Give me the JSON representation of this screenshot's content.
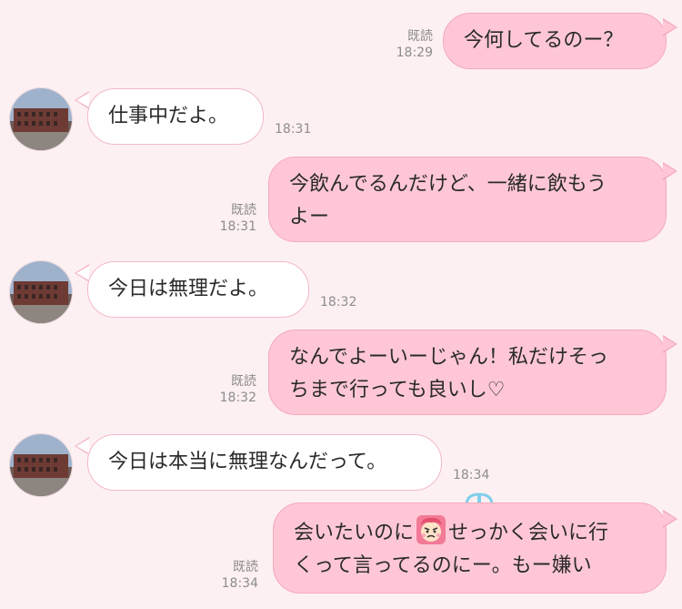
{
  "messages": [
    {
      "side": "out",
      "text": "今何してるのー？",
      "read": "既読",
      "time": "18:29"
    },
    {
      "side": "in",
      "text": "仕事中だよ。",
      "time": "18:31"
    },
    {
      "side": "out",
      "line1": "今飲んでるんだけど、一緒に飲もう",
      "line2": "よー",
      "read": "既読",
      "time": "18:31"
    },
    {
      "side": "in",
      "text": "今日は無理だよ。",
      "time": "18:32"
    },
    {
      "side": "out",
      "line1": "なんでよーいーじゃん！私だけそっ",
      "line2": "ちまで行っても良いし♡",
      "read": "既読",
      "time": "18:32"
    },
    {
      "side": "in",
      "text": "今日は本当に無理なんだって。",
      "time": "18:34"
    },
    {
      "side": "out",
      "line1_pre": "会いたいのに",
      "line1_post": "せっかく会いに行",
      "line2": "くって言ってるのにー。もー嫌い",
      "emoji": "angry-face-emoji",
      "read": "既読",
      "time": "18:34"
    }
  ],
  "colors": {
    "background": "#fdf0f2",
    "incoming_bubble": "#ffffff",
    "outgoing_bubble": "#ffc7d6",
    "bubble_border": "#f3aabd",
    "meta_text": "#8c8c8c"
  }
}
